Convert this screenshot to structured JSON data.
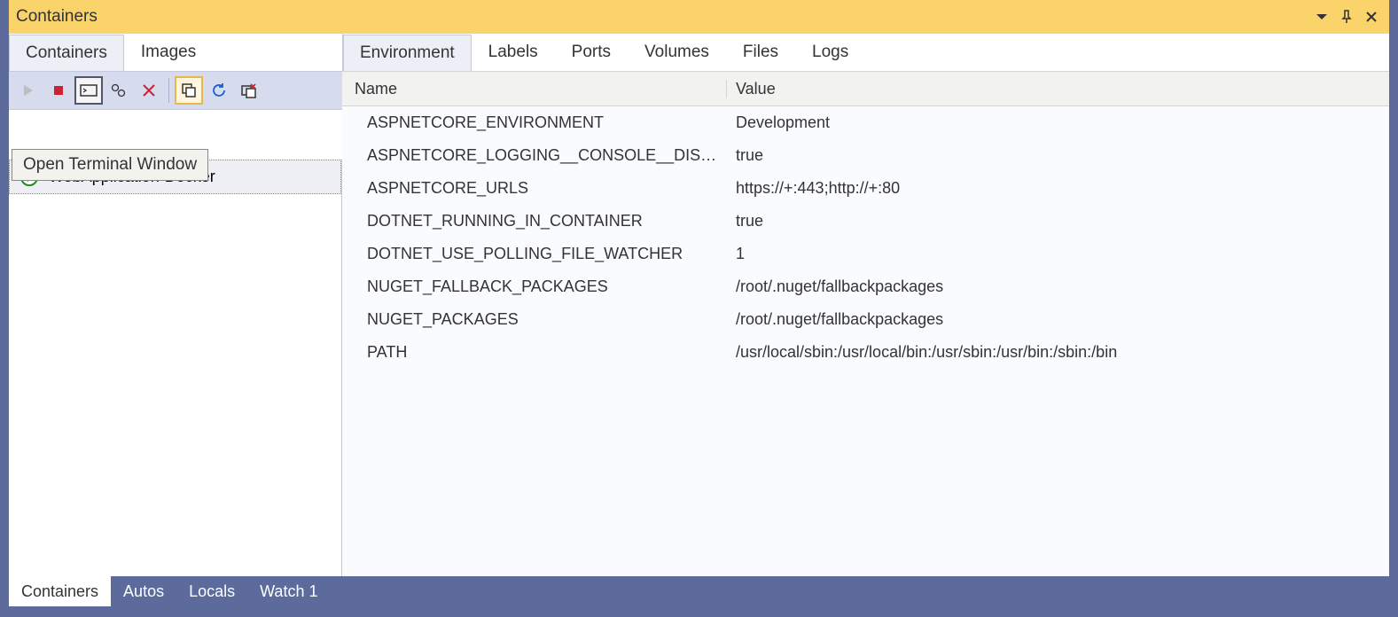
{
  "titlebar": {
    "title": "Containers"
  },
  "leftTabs": [
    {
      "label": "Containers",
      "active": true
    },
    {
      "label": "Images",
      "active": false
    }
  ],
  "tooltip": "Open Terminal Window",
  "containers": [
    {
      "name": "WebApplication-Docker",
      "running": true
    }
  ],
  "rightTabs": [
    {
      "label": "Environment",
      "active": true
    },
    {
      "label": "Labels",
      "active": false
    },
    {
      "label": "Ports",
      "active": false
    },
    {
      "label": "Volumes",
      "active": false
    },
    {
      "label": "Files",
      "active": false
    },
    {
      "label": "Logs",
      "active": false
    }
  ],
  "columns": {
    "name": "Name",
    "value": "Value"
  },
  "envRows": [
    {
      "name": "ASPNETCORE_ENVIRONMENT",
      "value": "Development"
    },
    {
      "name": "ASPNETCORE_LOGGING__CONSOLE__DISA…",
      "value": "true"
    },
    {
      "name": "ASPNETCORE_URLS",
      "value": "https://+:443;http://+:80"
    },
    {
      "name": "DOTNET_RUNNING_IN_CONTAINER",
      "value": "true"
    },
    {
      "name": "DOTNET_USE_POLLING_FILE_WATCHER",
      "value": "1"
    },
    {
      "name": "NUGET_FALLBACK_PACKAGES",
      "value": "/root/.nuget/fallbackpackages"
    },
    {
      "name": "NUGET_PACKAGES",
      "value": "/root/.nuget/fallbackpackages"
    },
    {
      "name": "PATH",
      "value": "/usr/local/sbin:/usr/local/bin:/usr/sbin:/usr/bin:/sbin:/bin"
    }
  ],
  "bottomTabs": [
    {
      "label": "Containers",
      "active": true
    },
    {
      "label": "Autos",
      "active": false
    },
    {
      "label": "Locals",
      "active": false
    },
    {
      "label": "Watch 1",
      "active": false
    }
  ]
}
